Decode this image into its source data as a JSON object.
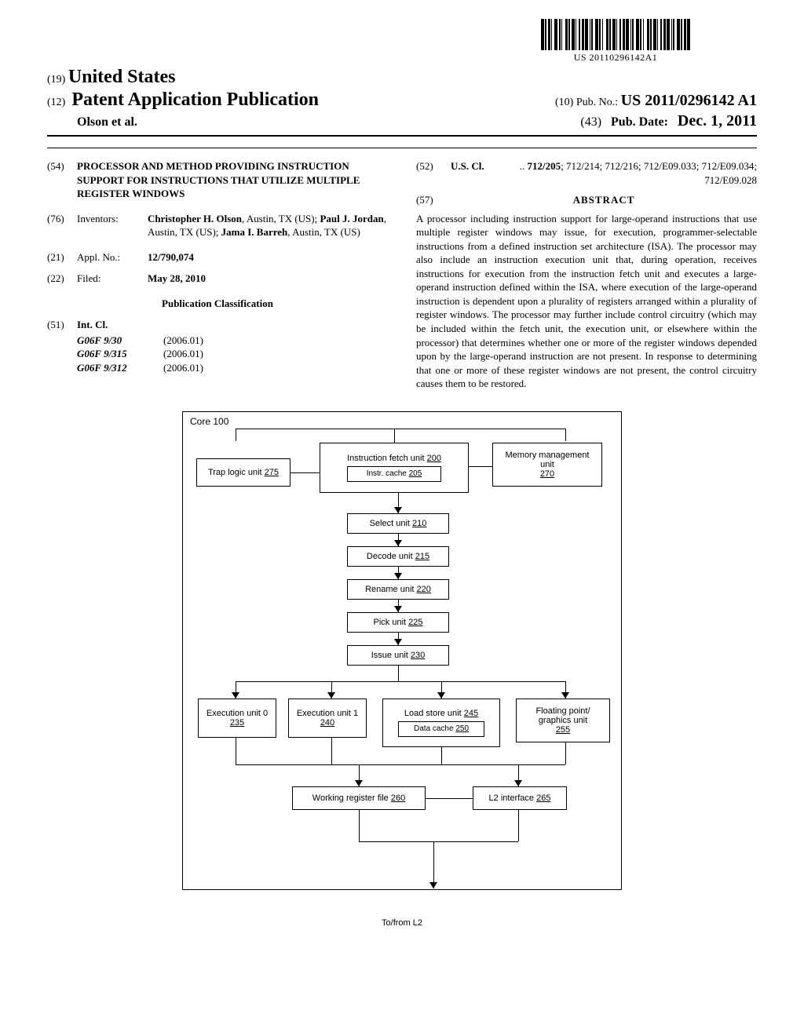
{
  "barcode_text": "US 20110296142A1",
  "header": {
    "authority_code": "(19)",
    "authority": "United States",
    "pub_code": "(12)",
    "pub_type": "Patent Application Publication",
    "authors_line": "Olson et al.",
    "pub_no_code": "(10)",
    "pub_no_label": "Pub. No.:",
    "pub_no_value": "US 2011/0296142 A1",
    "pub_date_code": "(43)",
    "pub_date_label": "Pub. Date:",
    "pub_date_value": "Dec. 1, 2011"
  },
  "left_col": {
    "title_code": "(54)",
    "title": "PROCESSOR AND METHOD PROVIDING INSTRUCTION SUPPORT FOR INSTRUCTIONS THAT UTILIZE MULTIPLE REGISTER WINDOWS",
    "inventors_code": "(76)",
    "inventors_label": "Inventors:",
    "inventors_value": "Christopher H. Olson, Austin, TX (US); Paul J. Jordan, Austin, TX (US); Jama I. Barreh, Austin, TX (US)",
    "appl_code": "(21)",
    "appl_label": "Appl. No.:",
    "appl_value": "12/790,074",
    "filed_code": "(22)",
    "filed_label": "Filed:",
    "filed_value": "May 28, 2010",
    "pub_class_heading": "Publication Classification",
    "intcl_code": "(51)",
    "intcl_label": "Int. Cl.",
    "intcl": [
      {
        "code": "G06F 9/30",
        "ver": "(2006.01)"
      },
      {
        "code": "G06F 9/315",
        "ver": "(2006.01)"
      },
      {
        "code": "G06F 9/312",
        "ver": "(2006.01)"
      }
    ]
  },
  "right_col": {
    "uscl_code": "(52)",
    "uscl_label": "U.S. Cl.",
    "uscl_value": ".. 712/205; 712/214; 712/216; 712/E09.033; 712/E09.034; 712/E09.028",
    "abstract_code": "(57)",
    "abstract_heading": "ABSTRACT",
    "abstract_text": "A processor including instruction support for large-operand instructions that use multiple register windows may issue, for execution, programmer-selectable instructions from a defined instruction set architecture (ISA). The processor may also include an instruction execution unit that, during operation, receives instructions for execution from the instruction fetch unit and executes a large-operand instruction defined within the ISA, where execution of the large-operand instruction is dependent upon a plurality of registers arranged within a plurality of register windows. The processor may further include control circuitry (which may be included within the fetch unit, the execution unit, or elsewhere within the processor) that determines whether one or more of the register windows depended upon by the large-operand instruction are not present. In response to determining that one or more of these register windows are not present, the control circuitry causes them to be restored."
  },
  "diagram": {
    "outer_label": "Core",
    "outer_num": "100",
    "blocks": {
      "ifu": {
        "label": "Instruction fetch unit",
        "num": "200"
      },
      "icache": {
        "label": "Instr. cache",
        "num": "205"
      },
      "trap": {
        "label": "Trap logic unit",
        "num": "275"
      },
      "mmu": {
        "label": "Memory management unit",
        "num": "270"
      },
      "select": {
        "label": "Select unit",
        "num": "210"
      },
      "decode": {
        "label": "Decode unit",
        "num": "215"
      },
      "rename": {
        "label": "Rename unit",
        "num": "220"
      },
      "pick": {
        "label": "Pick unit",
        "num": "225"
      },
      "issue": {
        "label": "Issue unit",
        "num": "230"
      },
      "ex0": {
        "label": "Execution unit 0",
        "num": "235"
      },
      "ex1": {
        "label": "Execution unit 1",
        "num": "240"
      },
      "lsu": {
        "label": "Load store unit",
        "num": "245"
      },
      "dcache": {
        "label": "Data cache",
        "num": "250"
      },
      "fgu": {
        "label": "Floating point/ graphics unit",
        "num": "255"
      },
      "wrf": {
        "label": "Working register file",
        "num": "260"
      },
      "l2if": {
        "label": "L2 interface",
        "num": "265"
      }
    },
    "tofrom": "To/from L2"
  }
}
